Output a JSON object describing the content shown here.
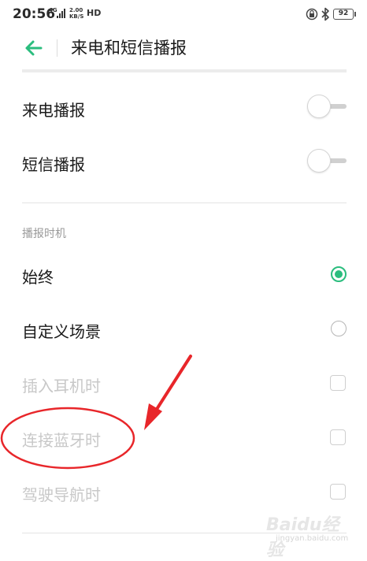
{
  "status_bar": {
    "time": "20:56",
    "network": "4G",
    "speed_value": "2.00",
    "speed_unit": "KB/S",
    "hd": "HD",
    "battery": "92"
  },
  "header": {
    "title": "来电和短信播报",
    "back_icon": "arrow-left-icon"
  },
  "settings": {
    "toggles": [
      {
        "label": "来电播报",
        "enabled": false
      },
      {
        "label": "短信播报",
        "enabled": false
      }
    ],
    "section_header": "播报时机",
    "radio_options": [
      {
        "label": "始终",
        "selected": true
      },
      {
        "label": "自定义场景",
        "selected": false
      }
    ],
    "scenes": [
      {
        "label": "插入耳机时",
        "checked": false,
        "enabled": false
      },
      {
        "label": "连接蓝牙时",
        "checked": false,
        "enabled": false
      },
      {
        "label": "驾驶导航时",
        "checked": false,
        "enabled": false
      }
    ]
  },
  "watermark": {
    "text": "Baidu经验",
    "sub": "jingyan.baidu.com"
  },
  "colors": {
    "accent": "#2bbd7e",
    "annotation": "#e8262a"
  }
}
